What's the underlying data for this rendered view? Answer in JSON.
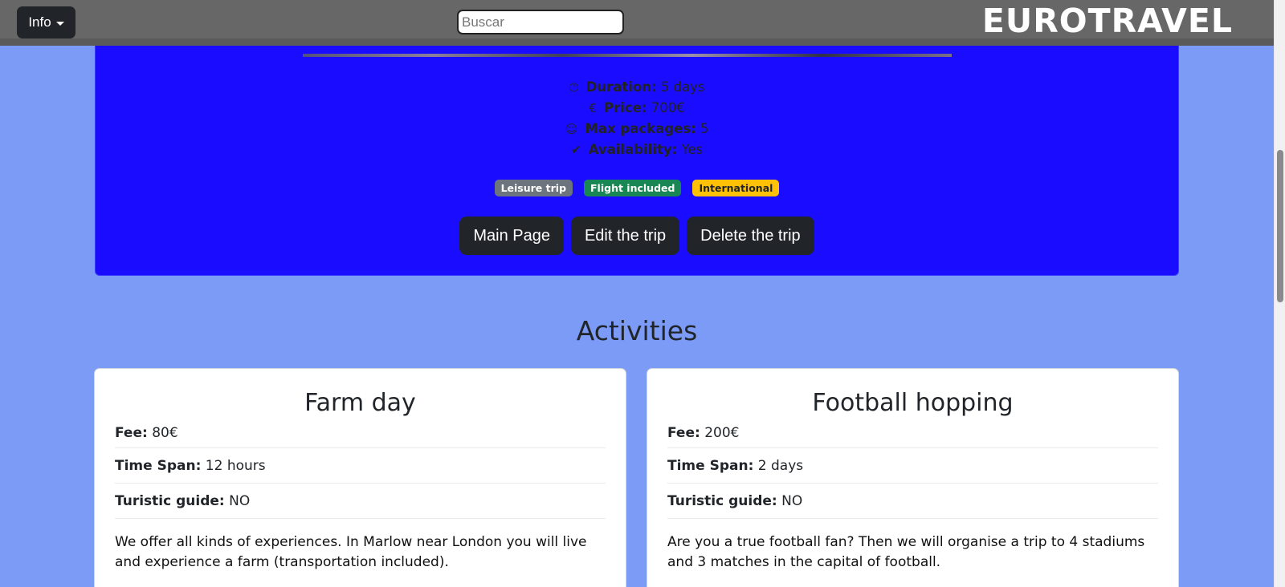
{
  "navbar": {
    "info_label": "Info",
    "search_placeholder": "Buscar",
    "brand": "EUROTRAVEL"
  },
  "trip": {
    "duration_label": "Duration:",
    "duration_value": "5 days",
    "price_label": "Price:",
    "price_value": "700€",
    "max_label": "Max packages:",
    "max_value": "5",
    "availability_label": "Availability:",
    "availability_value": "Yes",
    "icons": [
      "clock-icon",
      "euro-icon",
      "people-icon",
      "check-circle-icon"
    ],
    "badges": [
      "Leisure trip",
      "Flight included",
      "International"
    ],
    "buttons": [
      "Main Page",
      "Edit the trip",
      "Delete the trip"
    ]
  },
  "activities": {
    "title": "Activities",
    "items": [
      {
        "name": "Farm day",
        "fee_label": "Fee:",
        "fee": "80€",
        "span_label": "Time Span:",
        "span": "12 hours",
        "guide_label": "Turistic guide:",
        "guide": "NO",
        "description": "We offer all kinds of experiences. In Marlow near London you will live and experience a farm (transportation included)."
      },
      {
        "name": "Football hopping",
        "fee_label": "Fee:",
        "fee": "200€",
        "span_label": "Time Span:",
        "span": "2 days",
        "guide_label": "Turistic guide:",
        "guide": "NO",
        "description": "Are you a true football fan? Then we will organise a trip to 4 stadiums and 3 matches in the capital of football."
      }
    ]
  },
  "colors": {
    "page_bg": "#7b9bf6",
    "trip_card_bg": "#1a0dff",
    "navbar_bg": "#676767",
    "button_dark": "#212529"
  }
}
